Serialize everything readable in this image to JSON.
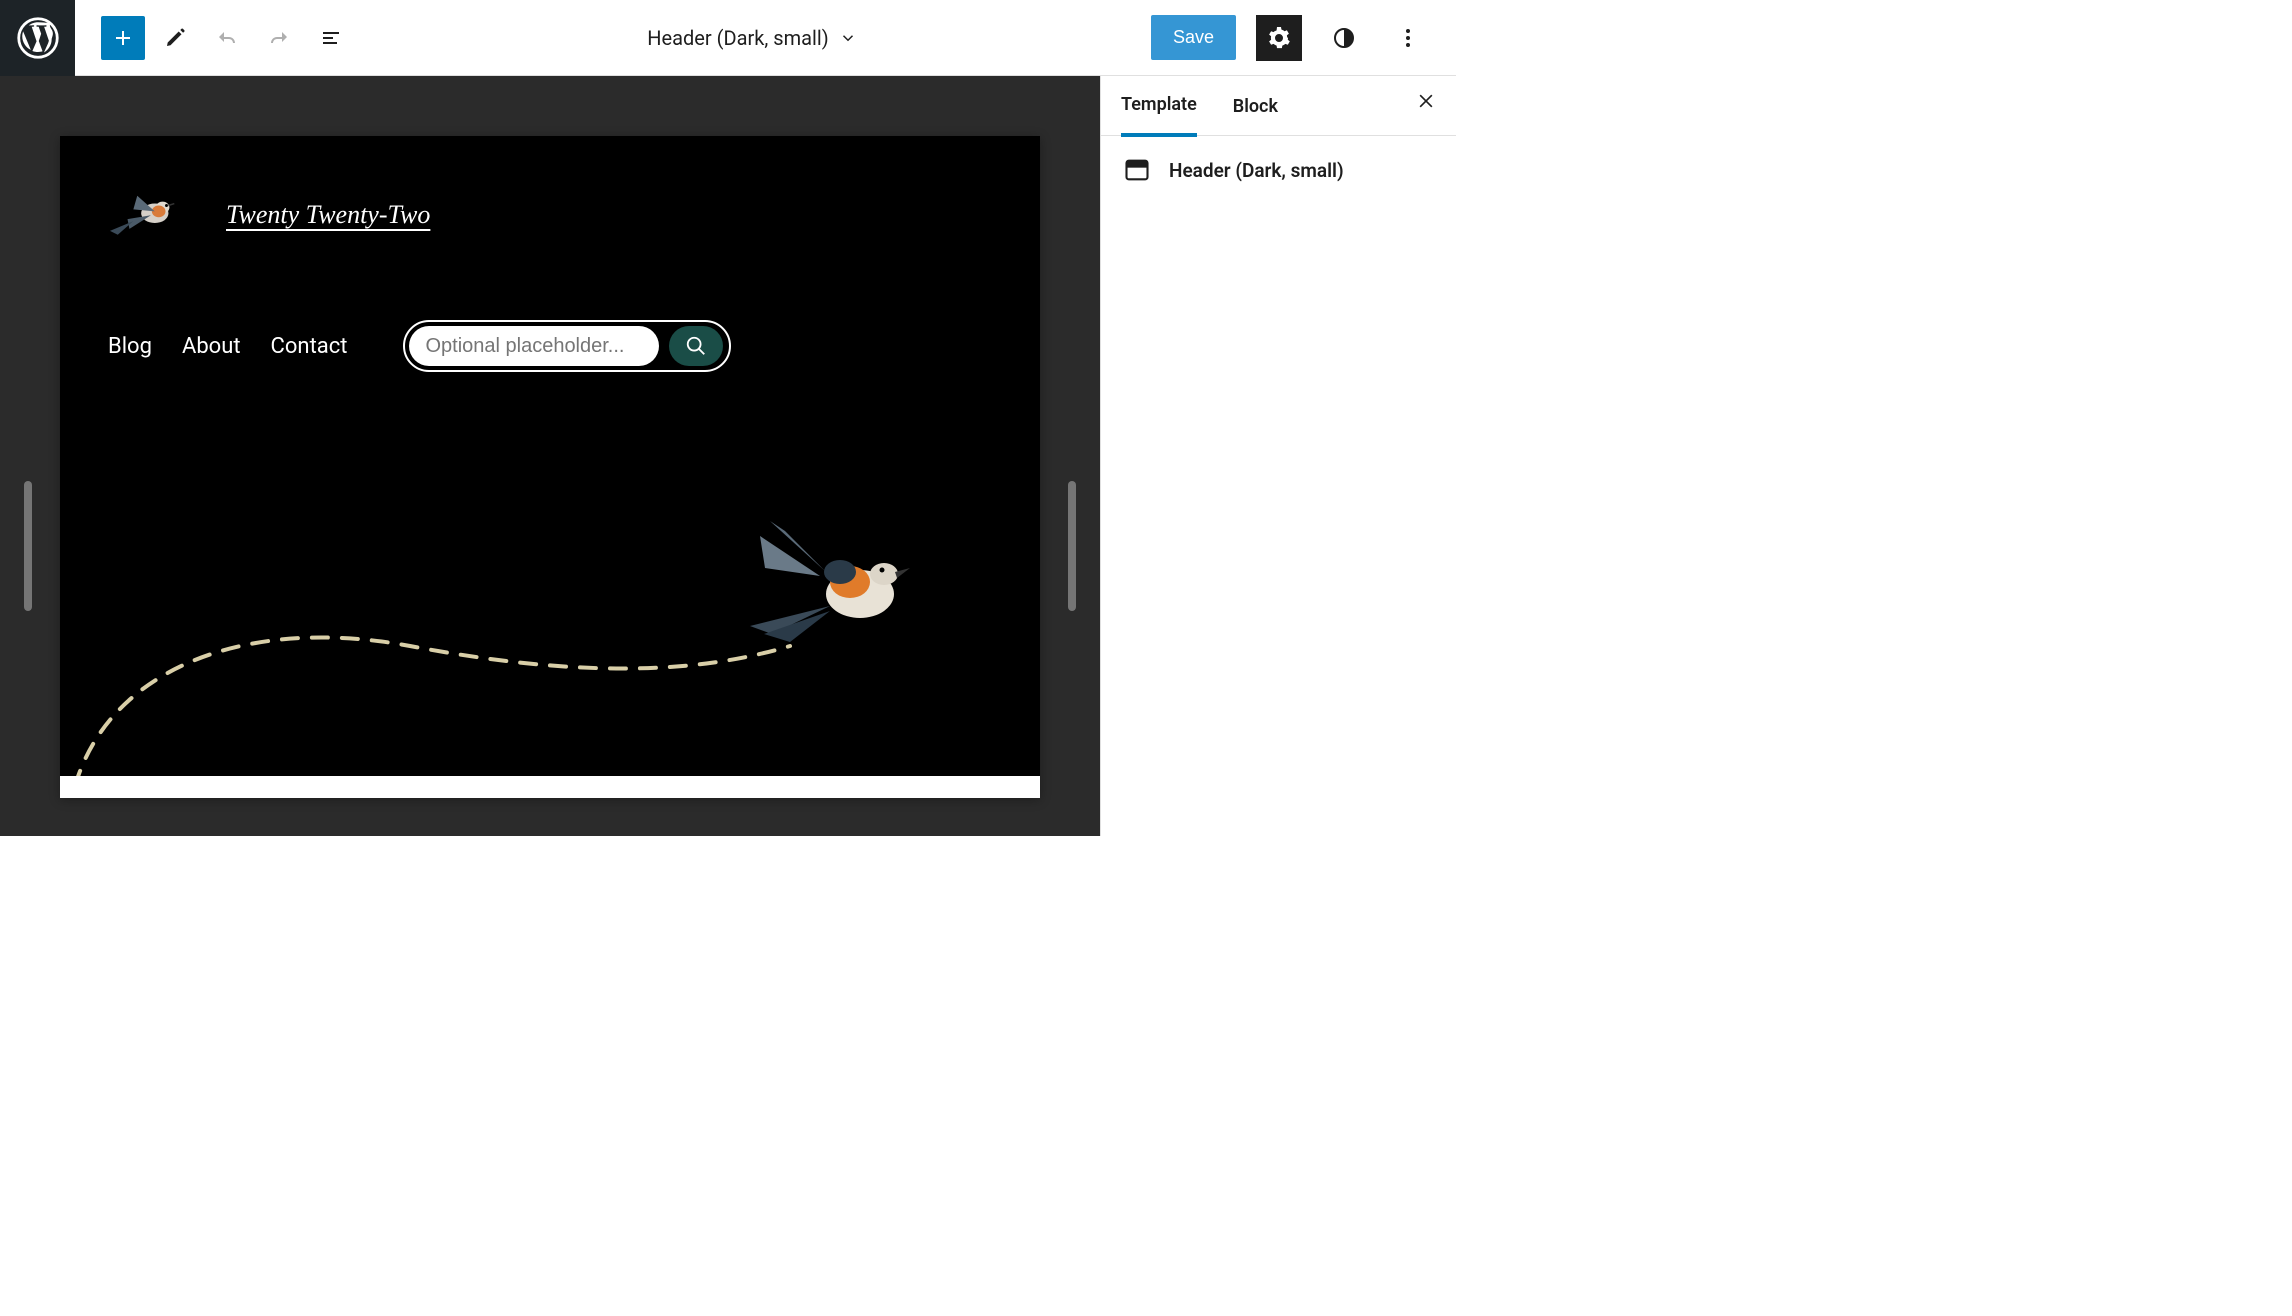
{
  "toolbar": {
    "document_title": "Header (Dark, small)",
    "save_label": "Save"
  },
  "sidebar": {
    "tabs": [
      "Template",
      "Block"
    ],
    "active_tab": 0,
    "panel_title": "Header (Dark, small)"
  },
  "preview": {
    "site_title": "Twenty Twenty-Two",
    "nav": [
      "Blog",
      "About",
      "Contact"
    ],
    "search_placeholder": "Optional placeholder..."
  },
  "icons": {
    "wp": "wordpress-logo",
    "add": "plus-icon",
    "edit": "pencil-icon",
    "undo": "undo-icon",
    "redo": "redo-icon",
    "list": "list-view-icon",
    "chevron": "chevron-down-icon",
    "gear": "gear-icon",
    "styles": "styles-icon",
    "more": "more-vertical-icon",
    "close": "close-icon",
    "header": "header-block-icon",
    "search": "search-icon"
  }
}
